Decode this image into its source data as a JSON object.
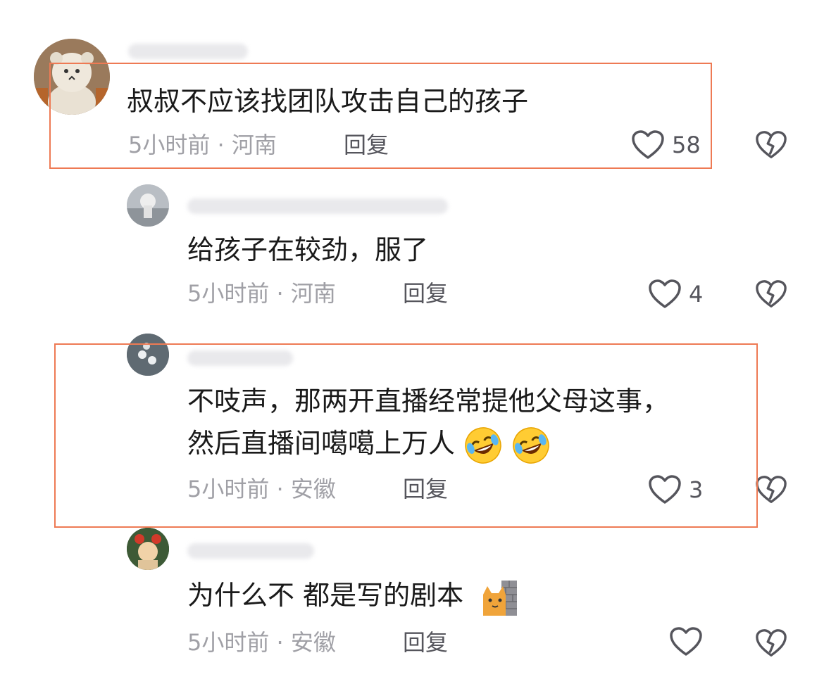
{
  "colors": {
    "highlight": "#ee7a54",
    "meta": "#a0a0a6",
    "text": "#1a1a1a"
  },
  "comments": [
    {
      "text_lines": [
        "叔叔不应该找团队攻击自己的孩子"
      ],
      "time": "5小时前",
      "separator": "·",
      "location": "河南",
      "reply_label": "回复",
      "likes": "58"
    },
    {
      "text_lines": [
        "给孩子在较劲，服了"
      ],
      "time": "5小时前",
      "separator": "·",
      "location": "河南",
      "reply_label": "回复",
      "likes": "4"
    },
    {
      "text_lines": [
        "不吱声，那两开直播经常提他父母这事，",
        "然后直播间噶噶上万人"
      ],
      "emojis": [
        "rofl-emoji",
        "rofl-emoji"
      ],
      "time": "5小时前",
      "separator": "·",
      "location": "安徽",
      "reply_label": "回复",
      "likes": "3"
    },
    {
      "text_lines": [
        "为什么不 都是写的剧本"
      ],
      "emojis": [
        "cat-behind-wall-emoji"
      ],
      "time": "5小时前",
      "separator": "·",
      "location": "安徽",
      "reply_label": "回复",
      "likes": ""
    }
  ]
}
